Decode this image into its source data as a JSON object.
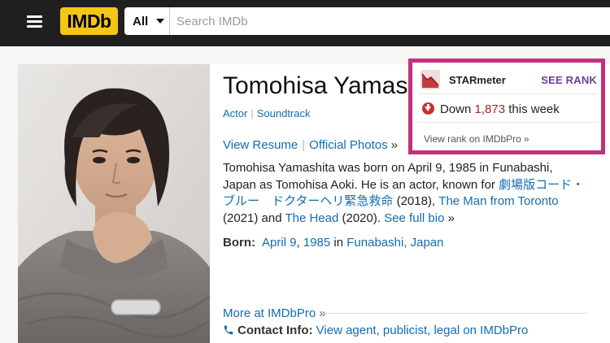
{
  "nav": {
    "logo_text": "IMDb",
    "search_category": "All",
    "search_placeholder": "Search IMDb"
  },
  "person": {
    "name": "Tomohisa Yamashita",
    "roles": [
      "Actor",
      "Soundtrack"
    ],
    "links": {
      "resume": "View Resume",
      "photos": "Official Photos",
      "raquo": "»"
    },
    "bio": {
      "text1": "Tomohisa Yamashita was born on April 9, 1985 in Funabashi, Japan as Tomohisa Aoki. He is an actor, known for ",
      "film1": "劇場版コード・ブルー　ドクターヘリ緊急救命",
      "text2": " (2018), ",
      "film2": "The Man from Toronto",
      "text3": " (2021) and ",
      "film3": "The Head",
      "text4": " (2020). ",
      "full_bio": "See full bio",
      "raquo": "»"
    },
    "born": {
      "label": "Born:",
      "date_day": "April 9",
      "comma": ", ",
      "year": "1985",
      "in": " in ",
      "place": "Funabashi, Japan"
    },
    "more": {
      "label": "More at IMDbPro",
      "raquo": "»"
    },
    "contact": {
      "label": "Contact Info:",
      "link": "View agent, publicist, legal on IMDbPro"
    }
  },
  "starmeter": {
    "title": "STARmeter",
    "see_rank": "SEE RANK",
    "direction": "Down",
    "change": "1,873",
    "period": "this week",
    "pro_link": "View rank on IMDbPro",
    "raquo": "»"
  },
  "colors": {
    "imdb_yellow": "#f5c518",
    "link_blue": "#136cb2",
    "highlight_border": "#c3307b",
    "down_red": "#c62e2e",
    "see_rank_purple": "#6b3fa0"
  }
}
